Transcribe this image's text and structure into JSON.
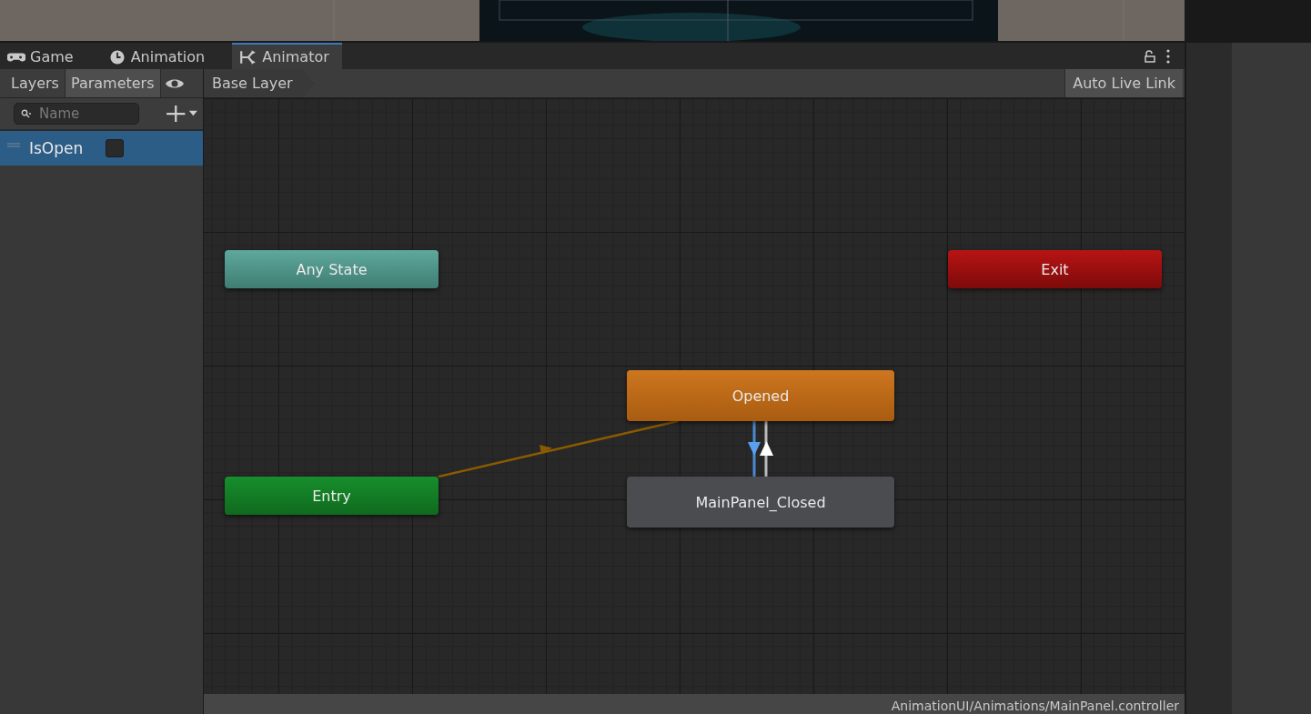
{
  "tabs": [
    {
      "label": "Game",
      "kind": "gamepad",
      "selected": false
    },
    {
      "label": "Animation",
      "kind": "clock",
      "selected": false
    },
    {
      "label": "Animator",
      "kind": "animator",
      "selected": true
    }
  ],
  "side_tabs": [
    {
      "label": "Layers",
      "selected": false
    },
    {
      "label": "Parameters",
      "selected": true
    }
  ],
  "breadcrumb": "Base Layer",
  "auto_live_link": "Auto Live Link",
  "search": {
    "placeholder": "Name"
  },
  "parameters": [
    {
      "name": "IsOpen",
      "selected": true,
      "checked": false
    }
  ],
  "nodes": [
    {
      "label": "Any State",
      "kind": "any"
    },
    {
      "label": "Exit",
      "kind": "exit"
    },
    {
      "label": "Opened",
      "kind": "default"
    },
    {
      "label": "Entry",
      "kind": "entry"
    },
    {
      "label": "MainPanel_Closed",
      "kind": "state"
    }
  ],
  "status_bar": "AnimationUI/Animations/MainPanel.controller"
}
